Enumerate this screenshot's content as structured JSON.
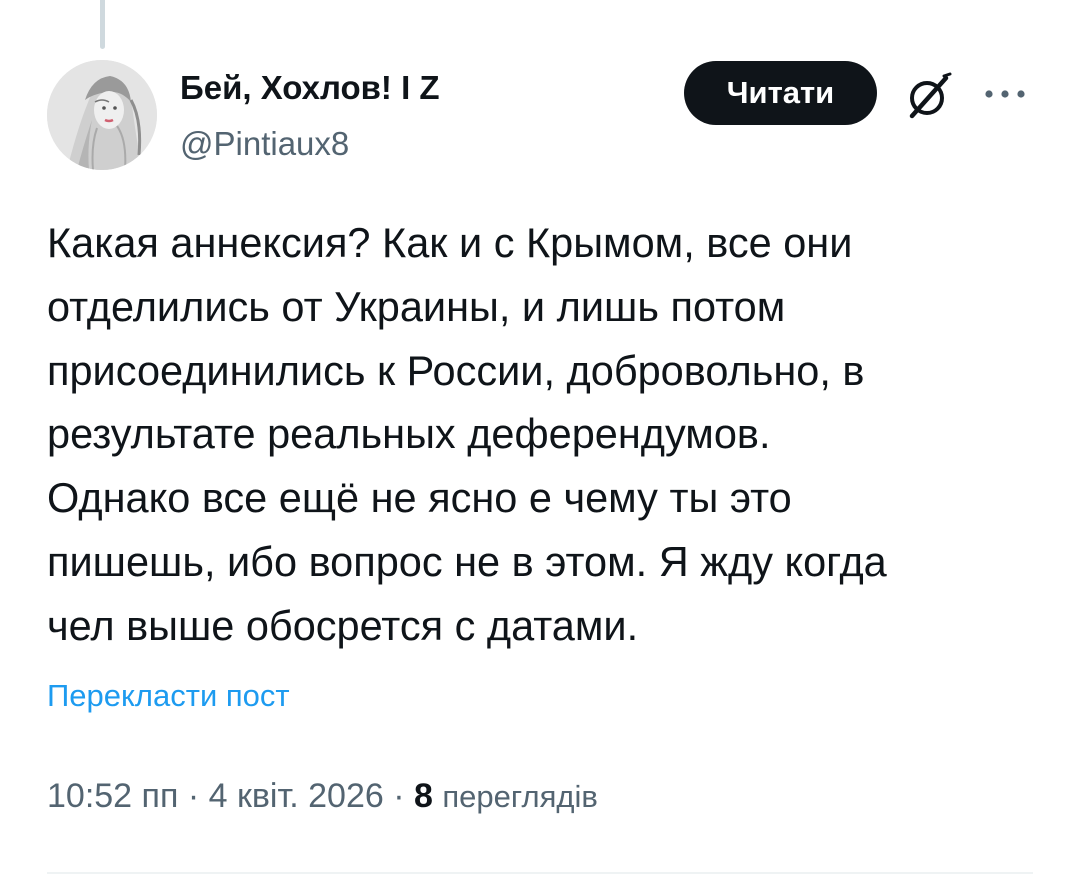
{
  "author": {
    "display_name": "Бей, Хохлов! I Z",
    "handle": "@Pintiaux8",
    "avatar_icon": "sketch-portrait-avatar"
  },
  "actions": {
    "follow_label": "Читати",
    "grok_icon": "grok-icon",
    "more_icon": "more-horizontal-icon"
  },
  "tweet": {
    "lines": [
      "Какая аннексия? Как и с Крымом, все они",
      "отделились от Украины, и лишь потом",
      "присоединились к России, добровольно, в",
      "результате реальных деферендумов.",
      "Однако все ещё не ясно е чему ты это",
      "пишешь, ибо вопрос не в этом. Я жду когда",
      "чел выше обосрется с датами."
    ],
    "translate_label": "Перекласти пост"
  },
  "meta": {
    "time": "10:52 пп",
    "separator": "·",
    "date": "4 квіт. 2026",
    "views_count": "8",
    "views_label": "переглядів"
  },
  "colors": {
    "text_primary": "#0f1419",
    "text_secondary": "#536471",
    "link": "#1d9bf0",
    "button_bg": "#0f1419"
  }
}
